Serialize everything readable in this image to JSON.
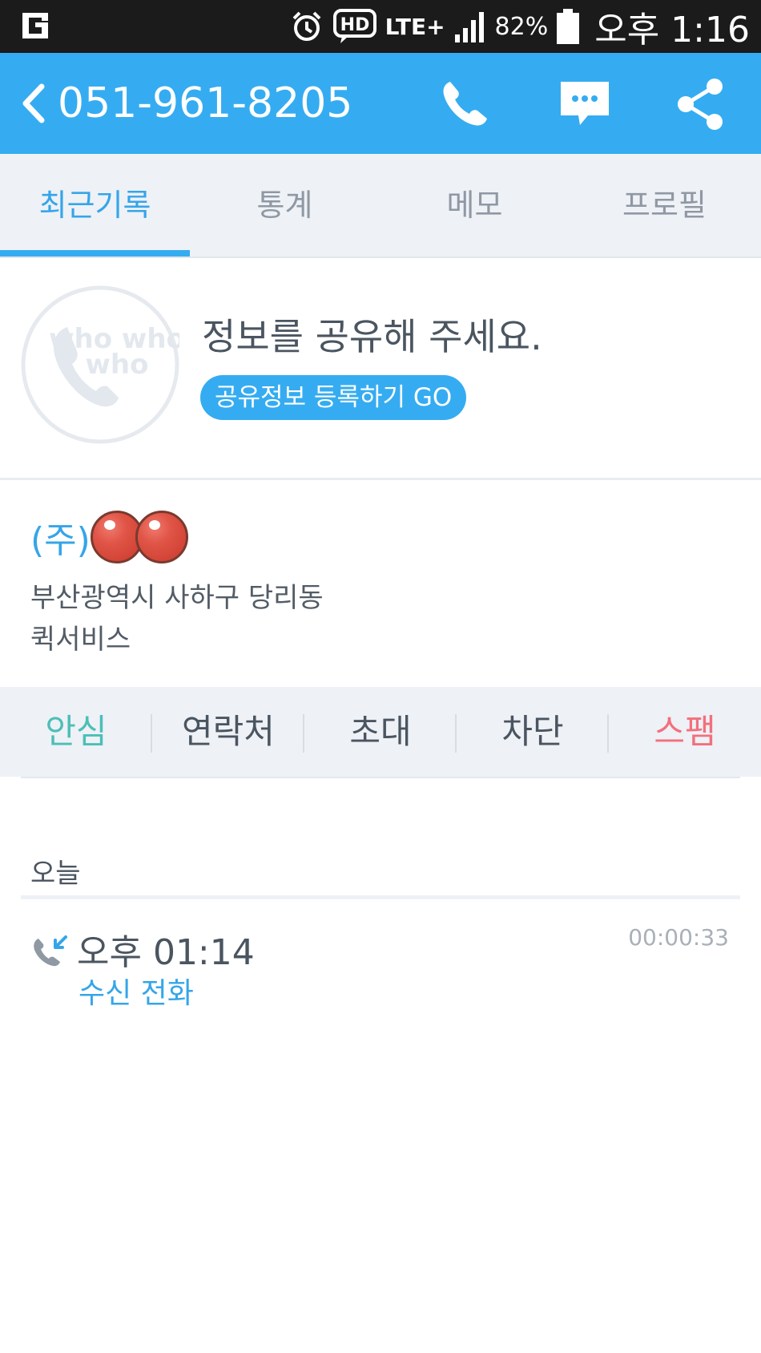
{
  "status_bar": {
    "battery_percent": "82%",
    "time": "오후 1:16",
    "network": "LTE+",
    "hd": "HD",
    "icons": [
      "carrier-logo-icon",
      "alarm-icon",
      "hd-voice-icon",
      "lte-icon",
      "signal-icon",
      "battery-icon"
    ]
  },
  "app_bar": {
    "phone_number": "051-961-8205",
    "icons": [
      "back-icon",
      "call-icon",
      "message-icon",
      "share-icon"
    ],
    "color": "#35acf1"
  },
  "tabs": [
    {
      "label": "최근기록",
      "active": true
    },
    {
      "label": "통계",
      "active": false
    },
    {
      "label": "메모",
      "active": false
    },
    {
      "label": "프로필",
      "active": false
    }
  ],
  "profile": {
    "avatar_text": "who who",
    "headline": "정보를 공유해 주세요.",
    "share_button": "공유정보 등록하기 GO"
  },
  "company": {
    "prefix": "(주)",
    "address": "부산광역시 사하구 당리동",
    "category": "퀵서비스"
  },
  "actions": [
    {
      "label": "안심",
      "color": "#4bbfb7"
    },
    {
      "label": "연락처",
      "color": "#4a5560"
    },
    {
      "label": "초대",
      "color": "#4a5560"
    },
    {
      "label": "차단",
      "color": "#4a5560"
    },
    {
      "label": "스팸",
      "color": "#f2707c"
    }
  ],
  "history": {
    "day_label": "오늘",
    "entries": [
      {
        "time": "오후 01:14",
        "type": "수신 전화",
        "duration": "00:00:33",
        "icon": "incoming-call-icon"
      }
    ]
  }
}
